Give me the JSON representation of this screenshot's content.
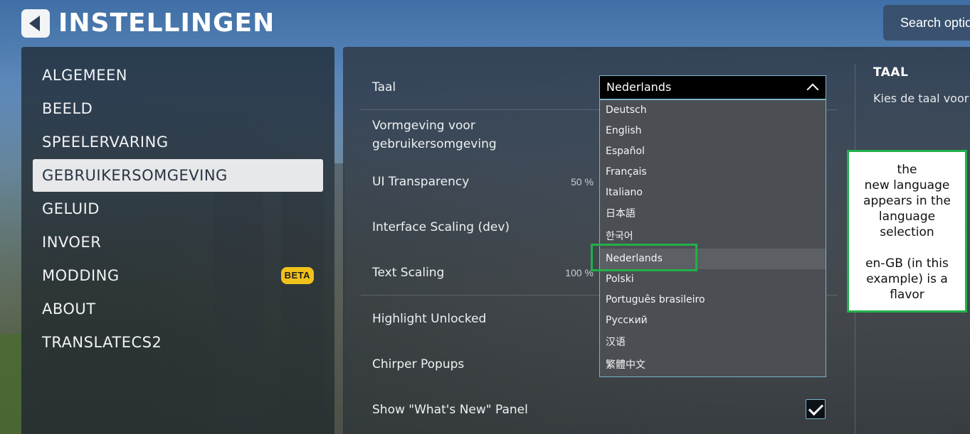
{
  "header": {
    "title": "INSTELLINGEN",
    "search_label": "Search options"
  },
  "sidebar": {
    "items": [
      {
        "label": "ALGEMEEN"
      },
      {
        "label": "BEELD"
      },
      {
        "label": "SPEELERVARING"
      },
      {
        "label": "GEBRUIKERSOMGEVING",
        "active": true
      },
      {
        "label": "GELUID"
      },
      {
        "label": "INVOER"
      },
      {
        "label": "MODDING",
        "badge": "BETA"
      },
      {
        "label": "ABOUT"
      },
      {
        "label": "TRANSLATECS2"
      }
    ]
  },
  "settings": {
    "language_label": "Taal",
    "ui_style_label": "Vormgeving voor gebruikersomgeving",
    "ui_transparency_label": "UI Transparency",
    "ui_transparency_value": "50 %",
    "interface_scaling_label": "Interface Scaling (dev)",
    "text_scaling_label": "Text Scaling",
    "text_scaling_value": "100 %",
    "highlight_unlocked_label": "Highlight Unlocked",
    "chirper_popups_label": "Chirper Popups",
    "whats_new_label": "Show \"What's New\" Panel",
    "whats_new_checked": true
  },
  "language_dropdown": {
    "selected": "Nederlands",
    "options": [
      "Deutsch",
      "English",
      "Español",
      "Français",
      "Italiano",
      "日本語",
      "한국어",
      "Nederlands",
      "Polski",
      "Português brasileiro",
      "Русский",
      "汉语",
      "繁體中文"
    ]
  },
  "info_panel": {
    "title": "TAAL",
    "description": "Kies de taal voor"
  },
  "annotation": {
    "line1": "the",
    "line2": "new language",
    "line3": "appears in the",
    "line4": "language",
    "line5": "selection",
    "line6": "en-GB (in this",
    "line7": "example) is a",
    "line8": "flavor"
  },
  "colors": {
    "accent_border": "#7bb3c9",
    "highlight_green": "#22b04a",
    "badge_yellow": "#f1c21b"
  }
}
